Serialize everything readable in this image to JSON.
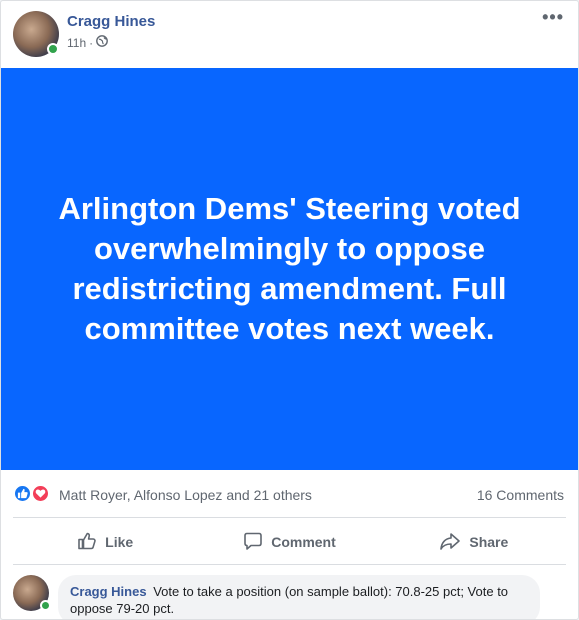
{
  "post": {
    "author": "Cragg Hines",
    "time": "11h",
    "separator": "·",
    "more_label": "•••",
    "banner_text": "Arlington Dems' Steering voted overwhelmingly to oppose redistricting amendment. Full committee votes next week.",
    "banner_color": "#0866ff"
  },
  "reactions": {
    "names": "Matt Royer, Alfonso Lopez and 21 others",
    "comments_count": "16 Comments"
  },
  "actions": {
    "like": "Like",
    "comment": "Comment",
    "share": "Share"
  },
  "comment": {
    "author": "Cragg Hines",
    "text": "Vote to take a position (on sample ballot): 70.8-25 pct; Vote to oppose 79-20 pct."
  },
  "colors": {
    "name_link": "#385898",
    "online": "#31a24c",
    "like": "#1877f2",
    "love": "#f33e58"
  }
}
